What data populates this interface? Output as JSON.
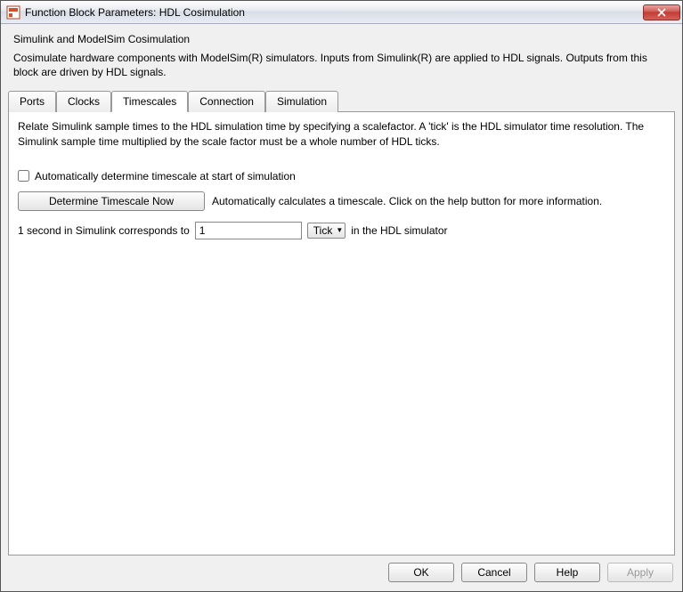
{
  "window": {
    "title": "Function Block Parameters: HDL Cosimulation"
  },
  "header": {
    "heading": "Simulink and ModelSim Cosimulation",
    "description": "Cosimulate hardware components with ModelSim(R) simulators. Inputs from Simulink(R) are applied to HDL signals. Outputs from this block are driven by HDL signals."
  },
  "tabs": {
    "ports": "Ports",
    "clocks": "Clocks",
    "timescales": "Timescales",
    "connection": "Connection",
    "simulation": "Simulation",
    "active": "timescales"
  },
  "timescales": {
    "description": "Relate Simulink sample times to the HDL simulation time by specifying a scalefactor. A 'tick' is the HDL simulator time resolution. The Simulink sample time multiplied by the scale factor must be a whole number of HDL ticks.",
    "auto_checkbox_label": "Automatically determine timescale at start of simulation",
    "auto_checked": false,
    "determine_button": "Determine Timescale Now",
    "determine_hint": "Automatically calculates a timescale. Click on the help button for more information.",
    "scale_prefix": "1 second in Simulink corresponds to",
    "scale_value": "1",
    "scale_unit": "Tick",
    "scale_suffix": "in the HDL simulator"
  },
  "footer": {
    "ok": "OK",
    "cancel": "Cancel",
    "help": "Help",
    "apply": "Apply"
  }
}
